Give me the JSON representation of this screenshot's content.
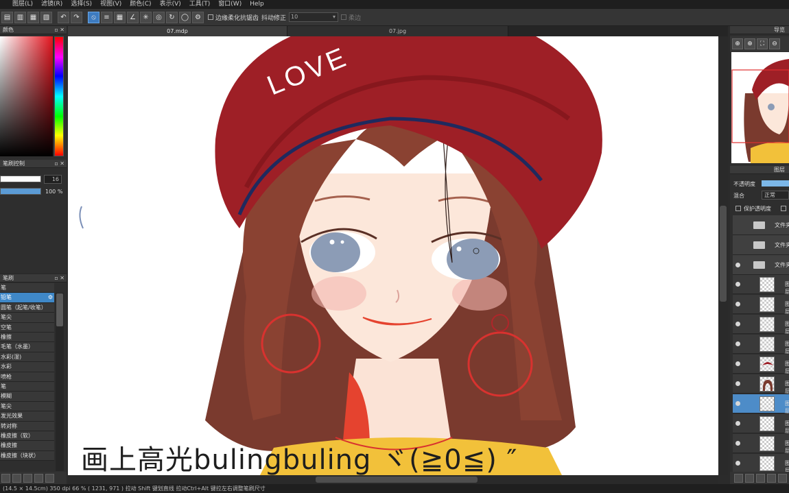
{
  "menubar": [
    "图层(L)",
    "滤镜(R)",
    "选择(S)",
    "视图(V)",
    "颜色(C)",
    "表示(V)",
    "工具(T)",
    "窗口(W)",
    "Help"
  ],
  "toolbar": {
    "antialias_label": "边缘柔化抗锯齿",
    "stabilizer_label": "抖动修正",
    "stabilizer_value": "10",
    "soft_label": "柔边"
  },
  "color_panel": {
    "title": "颜色"
  },
  "brush_control": {
    "title": "笔刷控制",
    "size_value": "16",
    "opacity_value": "100 %",
    "opacity_fraction": 1.0
  },
  "brush_list": {
    "title": "笔刷",
    "items": [
      "笔",
      "铅笔",
      "圆笔（起笔/收笔）",
      "笔尖",
      "空笔",
      "橡擦",
      "毛笔（水墨）",
      "水彩(湿)",
      "水彩",
      "喷枪",
      "笔",
      "模糊",
      "笔尖",
      "发光效果",
      "转对称",
      "橡皮擦（软）",
      "橡皮擦",
      "橡皮擦（块状）"
    ],
    "selected_index": 1
  },
  "tabs": [
    "07.mdp",
    "07.jpg"
  ],
  "canvas": {
    "hat_text": "LOVE",
    "caption": "画上高光bulingbuling ヾ(≧0≦) ″"
  },
  "status": "(14.5 × 14.5cm)  350 dpi  66 %  ( 1231, 971 )  拉动 Shift 键划直线  拉动Ctrl+Alt 键拉左右调整笔刷尺寸",
  "navigator": {
    "title": "导览"
  },
  "layers": {
    "title": "图层",
    "opacity_label": "不透明度",
    "blend_label": "混合",
    "blend_value": "正常",
    "protect_label": "保护透明度",
    "folders": [
      "文件夹",
      "文件夹",
      "文件夹"
    ],
    "layer_names": [
      "图层",
      "图层",
      "图层",
      "图层",
      "图层",
      "图层",
      "图层",
      "图层",
      "图层",
      "图层"
    ]
  },
  "colors": {
    "accent": "#3f88c8",
    "hat": "#9e1f26",
    "hair": "#7a3a2e",
    "earring": "#d8322f",
    "shirt": "#f2c13a"
  }
}
